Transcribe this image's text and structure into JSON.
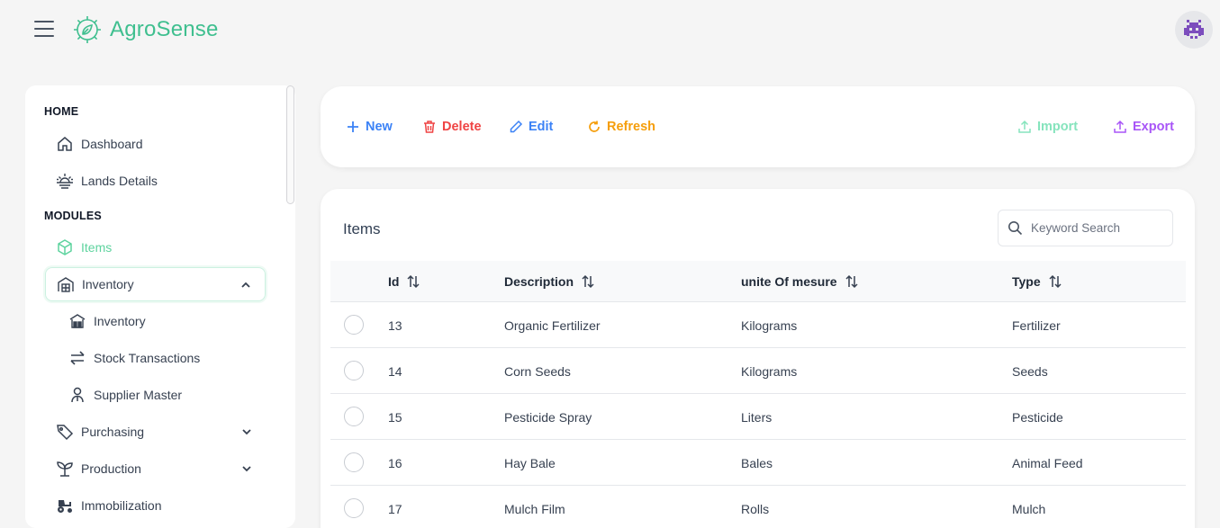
{
  "app": {
    "brand": "AgroSense",
    "accent": "#3fbf8f",
    "avatar_icon": "space-invader-icon"
  },
  "sidebar": {
    "sections": [
      {
        "label": "HOME"
      },
      {
        "label": "MODULES"
      }
    ],
    "home_items": [
      {
        "label": "Dashboard",
        "icon": "home-icon"
      },
      {
        "label": "Lands Details",
        "icon": "sunrise-icon"
      }
    ],
    "module_items": [
      {
        "label": "Items",
        "icon": "box-icon",
        "active": true
      },
      {
        "label": "Inventory",
        "icon": "warehouse-icon",
        "expanded": true
      },
      {
        "label": "Inventory",
        "icon": "warehouse-small-icon",
        "sub": true
      },
      {
        "label": "Stock Transactions",
        "icon": "arrows-exchange-icon",
        "sub": true
      },
      {
        "label": "Supplier Master",
        "icon": "user-pin-icon",
        "sub": true
      },
      {
        "label": "Purchasing",
        "icon": "tag-icon"
      },
      {
        "label": "Production",
        "icon": "sprout-icon"
      },
      {
        "label": "Immobilization",
        "icon": "tractor-icon"
      }
    ]
  },
  "toolbar": {
    "new": "New",
    "delete": "Delete",
    "edit": "Edit",
    "refresh": "Refresh",
    "import": "Import",
    "export": "Export"
  },
  "table": {
    "title": "Items",
    "search_placeholder": "Keyword Search",
    "columns": [
      "Id",
      "Description",
      "unite Of mesure",
      "Type"
    ],
    "rows": [
      {
        "id": "13",
        "description": "Organic Fertilizer",
        "uom": "Kilograms",
        "type": "Fertilizer"
      },
      {
        "id": "14",
        "description": "Corn Seeds",
        "uom": "Kilograms",
        "type": "Seeds"
      },
      {
        "id": "15",
        "description": "Pesticide Spray",
        "uom": "Liters",
        "type": "Pesticide"
      },
      {
        "id": "16",
        "description": "Hay Bale",
        "uom": "Bales",
        "type": "Animal Feed"
      },
      {
        "id": "17",
        "description": "Mulch Film",
        "uom": "Rolls",
        "type": "Mulch"
      }
    ]
  }
}
